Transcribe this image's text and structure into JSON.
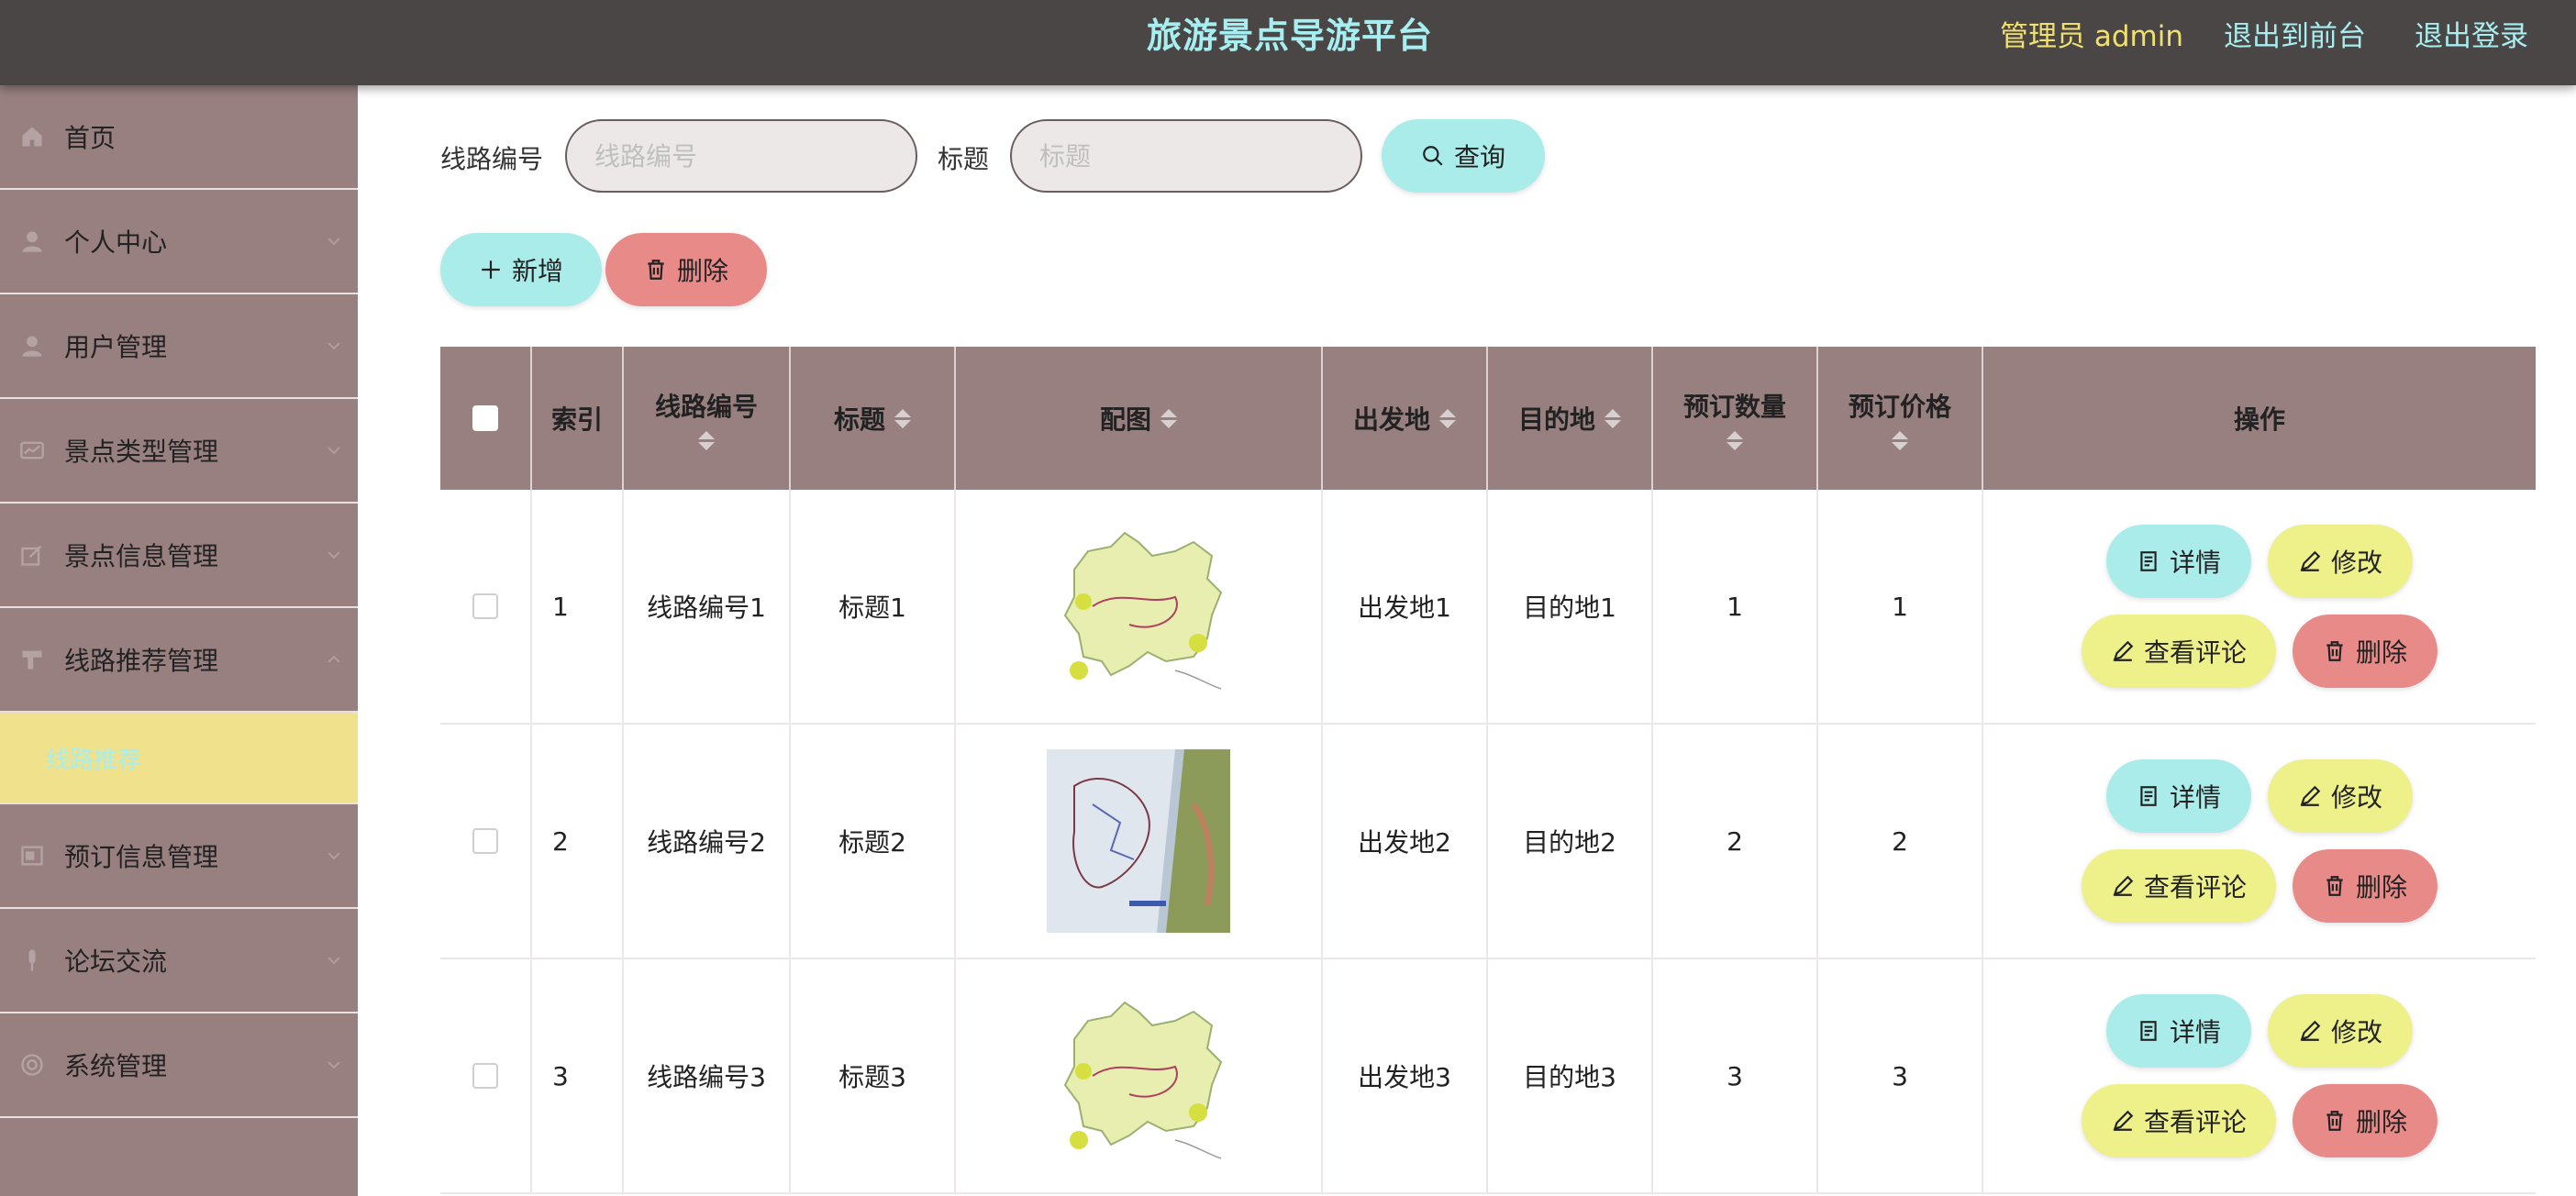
{
  "header": {
    "title": "旅游景点导游平台",
    "user_label": "管理员 admin",
    "to_front": "退出到前台",
    "logout": "退出登录"
  },
  "sidebar": {
    "items": [
      {
        "label": "首页",
        "icon": "home-icon"
      },
      {
        "label": "个人中心",
        "icon": "user-icon"
      },
      {
        "label": "用户管理",
        "icon": "user-icon"
      },
      {
        "label": "景点类型管理",
        "icon": "chart-icon"
      },
      {
        "label": "景点信息管理",
        "icon": "edit-icon"
      },
      {
        "label": "线路推荐管理",
        "icon": "flag-icon"
      },
      {
        "label": "预订信息管理",
        "icon": "book-icon"
      },
      {
        "label": "论坛交流",
        "icon": "mic-icon"
      },
      {
        "label": "系统管理",
        "icon": "settings-icon"
      }
    ],
    "active_sub": "线路推荐"
  },
  "search": {
    "route_no_label": "线路编号",
    "route_no_placeholder": "线路编号",
    "title_label": "标题",
    "title_placeholder": "标题",
    "query_btn": "查询"
  },
  "actions": {
    "add": "新增",
    "delete": "删除"
  },
  "table": {
    "headers": [
      "索引",
      "线路编号",
      "标题",
      "配图",
      "出发地",
      "目的地",
      "预订数量",
      "预订价格",
      "操作"
    ],
    "rows": [
      {
        "index": "1",
        "route_no": "线路编号1",
        "title": "标题1",
        "from": "出发地1",
        "to": "目的地1",
        "qty": "1",
        "price": "1",
        "image": "map-yunnan"
      },
      {
        "index": "2",
        "route_no": "线路编号2",
        "title": "标题2",
        "from": "出发地2",
        "to": "目的地2",
        "qty": "2",
        "price": "2",
        "image": "map-photo"
      },
      {
        "index": "3",
        "route_no": "线路编号3",
        "title": "标题3",
        "from": "出发地3",
        "to": "目的地3",
        "qty": "3",
        "price": "3",
        "image": "map-yunnan"
      }
    ],
    "ops": {
      "detail": "详情",
      "edit": "修改",
      "comments": "查看评论",
      "delete": "删除"
    }
  },
  "colors": {
    "header_bg": "#4b4646",
    "sidebar_bg": "#988080",
    "accent_cyan": "#a9ecea",
    "accent_yellow": "#eef08a",
    "accent_pink": "#e88a88"
  }
}
